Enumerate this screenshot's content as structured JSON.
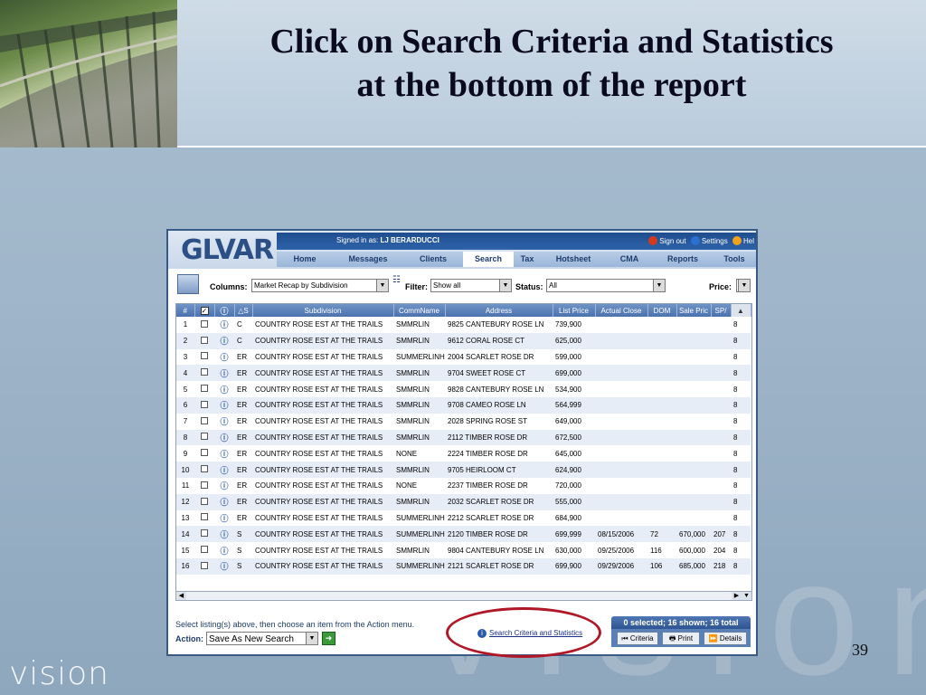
{
  "slide": {
    "title_line1": "Click on Search Criteria and Statistics",
    "title_line2": "at the bottom of the report",
    "logo_text": "vision",
    "watermark_text": "vision",
    "page_number": "39"
  },
  "app": {
    "logo": "GLVAR",
    "signed_in_label": "Signed in as:",
    "signed_in_user": "LJ BERARDUCCI",
    "top_links": [
      "Sign out",
      "Settings",
      "Hel"
    ],
    "nav_tabs": [
      "Home",
      "Messages",
      "Clients",
      "Search",
      "Tax",
      "Hotsheet",
      "CMA",
      "Reports",
      "Tools"
    ],
    "active_tab": "Search"
  },
  "toolbar": {
    "columns_label": "Columns:",
    "columns_value": "Market Recap by Subdivision",
    "filter_label": "Filter:",
    "filter_value": "Show all",
    "status_label": "Status:",
    "status_value": "All",
    "price_label": "Price:"
  },
  "grid": {
    "headers": [
      "#",
      "",
      "",
      "S",
      "Subdivision",
      "CommName",
      "Address",
      "List Price",
      "Actual Close",
      "DOM",
      "Sale Pric",
      "SP/",
      ""
    ],
    "rows": [
      {
        "n": "1",
        "s": "C",
        "sub": "COUNTRY ROSE EST AT THE TRAILS",
        "comm": "SMMRLIN",
        "addr": "9825 CANTEBURY ROSE LN",
        "list": "739,900",
        "close": "",
        "dom": "",
        "sale": "",
        "sp": "",
        "x": "8"
      },
      {
        "n": "2",
        "s": "C",
        "sub": "COUNTRY ROSE EST AT THE TRAILS",
        "comm": "SMMRLIN",
        "addr": "9612 CORAL ROSE CT",
        "list": "625,000",
        "close": "",
        "dom": "",
        "sale": "",
        "sp": "",
        "x": "8"
      },
      {
        "n": "3",
        "s": "ER",
        "sub": "COUNTRY ROSE EST AT THE TRAILS",
        "comm": "SUMMERLINH",
        "addr": "2004 SCARLET ROSE DR",
        "list": "599,000",
        "close": "",
        "dom": "",
        "sale": "",
        "sp": "",
        "x": "8"
      },
      {
        "n": "4",
        "s": "ER",
        "sub": "COUNTRY ROSE EST AT THE TRAILS",
        "comm": "SMMRLIN",
        "addr": "9704 SWEET ROSE CT",
        "list": "699,000",
        "close": "",
        "dom": "",
        "sale": "",
        "sp": "",
        "x": "8"
      },
      {
        "n": "5",
        "s": "ER",
        "sub": "COUNTRY ROSE EST AT THE TRAILS",
        "comm": "SMMRLIN",
        "addr": "9828 CANTEBURY ROSE LN",
        "list": "534,900",
        "close": "",
        "dom": "",
        "sale": "",
        "sp": "",
        "x": "8"
      },
      {
        "n": "6",
        "s": "ER",
        "sub": "COUNTRY ROSE EST AT THE TRAILS",
        "comm": "SMMRLIN",
        "addr": "9708 CAMEO ROSE LN",
        "list": "564,999",
        "close": "",
        "dom": "",
        "sale": "",
        "sp": "",
        "x": "8"
      },
      {
        "n": "7",
        "s": "ER",
        "sub": "COUNTRY ROSE EST AT THE TRAILS",
        "comm": "SMMRLIN",
        "addr": "2028 SPRING ROSE ST",
        "list": "649,000",
        "close": "",
        "dom": "",
        "sale": "",
        "sp": "",
        "x": "8"
      },
      {
        "n": "8",
        "s": "ER",
        "sub": "COUNTRY ROSE EST AT THE TRAILS",
        "comm": "SMMRLIN",
        "addr": "2112 TIMBER ROSE DR",
        "list": "672,500",
        "close": "",
        "dom": "",
        "sale": "",
        "sp": "",
        "x": "8"
      },
      {
        "n": "9",
        "s": "ER",
        "sub": "COUNTRY ROSE EST AT THE TRAILS",
        "comm": "NONE",
        "addr": "2224 TIMBER ROSE DR",
        "list": "645,000",
        "close": "",
        "dom": "",
        "sale": "",
        "sp": "",
        "x": "8"
      },
      {
        "n": "10",
        "s": "ER",
        "sub": "COUNTRY ROSE EST AT THE TRAILS",
        "comm": "SMMRLIN",
        "addr": "9705 HEIRLOOM CT",
        "list": "624,900",
        "close": "",
        "dom": "",
        "sale": "",
        "sp": "",
        "x": "8"
      },
      {
        "n": "11",
        "s": "ER",
        "sub": "COUNTRY ROSE EST AT THE TRAILS",
        "comm": "NONE",
        "addr": "2237 TIMBER ROSE DR",
        "list": "720,000",
        "close": "",
        "dom": "",
        "sale": "",
        "sp": "",
        "x": "8"
      },
      {
        "n": "12",
        "s": "ER",
        "sub": "COUNTRY ROSE EST AT THE TRAILS",
        "comm": "SMMRLIN",
        "addr": "2032 SCARLET ROSE DR",
        "list": "555,000",
        "close": "",
        "dom": "",
        "sale": "",
        "sp": "",
        "x": "8"
      },
      {
        "n": "13",
        "s": "ER",
        "sub": "COUNTRY ROSE EST AT THE TRAILS",
        "comm": "SUMMERLINH",
        "addr": "2212 SCARLET ROSE DR",
        "list": "684,900",
        "close": "",
        "dom": "",
        "sale": "",
        "sp": "",
        "x": "8"
      },
      {
        "n": "14",
        "s": "S",
        "sub": "COUNTRY ROSE EST AT THE TRAILS",
        "comm": "SUMMERLINH",
        "addr": "2120 TIMBER ROSE DR",
        "list": "699,999",
        "close": "08/15/2006",
        "dom": "72",
        "sale": "670,000",
        "sp": "207",
        "x": "8"
      },
      {
        "n": "15",
        "s": "S",
        "sub": "COUNTRY ROSE EST AT THE TRAILS",
        "comm": "SMMRLIN",
        "addr": "9804 CANTEBURY ROSE LN",
        "list": "630,000",
        "close": "09/25/2006",
        "dom": "116",
        "sale": "600,000",
        "sp": "204",
        "x": "8"
      },
      {
        "n": "16",
        "s": "S",
        "sub": "COUNTRY ROSE EST AT THE TRAILS",
        "comm": "SUMMERLINH",
        "addr": "2121 SCARLET ROSE DR",
        "list": "699,900",
        "close": "09/29/2006",
        "dom": "106",
        "sale": "685,000",
        "sp": "218",
        "x": "8"
      }
    ]
  },
  "footer": {
    "note": "Select listing(s) above, then choose an item from the Action menu.",
    "action_label": "Action:",
    "action_value": "Save As New Search",
    "search_criteria_link": "Search Criteria and Statistics",
    "summary": "0 selected; 16 shown; 16 total",
    "buttons": [
      "Criteria",
      "Print",
      "Details"
    ]
  },
  "colors": {
    "highlight_oval": "#b01828",
    "header_blue": "#4a72ad",
    "row_alt": "#e7edf6"
  }
}
